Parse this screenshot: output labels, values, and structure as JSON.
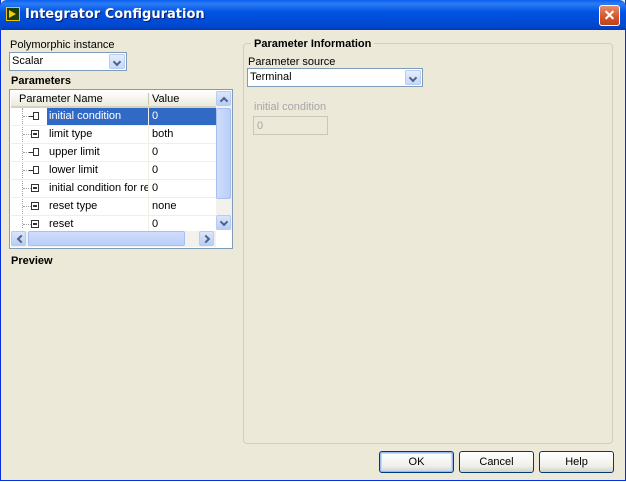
{
  "window": {
    "title": "Integrator Configuration"
  },
  "polymorphic": {
    "label": "Polymorphic instance",
    "value": "Scalar"
  },
  "parameters": {
    "title": "Parameters",
    "col_name": "Parameter Name",
    "col_value": "Value",
    "rows": [
      {
        "name": "initial condition",
        "value": "0",
        "icon": "terminal-icon",
        "selected": true
      },
      {
        "name": "limit type",
        "value": "both",
        "icon": "control-icon"
      },
      {
        "name": "upper limit",
        "value": "0",
        "icon": "terminal-icon"
      },
      {
        "name": "lower limit",
        "value": "0",
        "icon": "terminal-icon"
      },
      {
        "name": "initial condition for reset",
        "value": "0",
        "icon": "control-icon"
      },
      {
        "name": "reset type",
        "value": "none",
        "icon": "control-icon"
      },
      {
        "name": "reset",
        "value": "0",
        "icon": "control-icon"
      }
    ]
  },
  "preview": {
    "title": "Preview"
  },
  "info": {
    "title": "Parameter Information",
    "source_label": "Parameter source",
    "source_value": "Terminal",
    "field_label": "initial condition",
    "field_value": "0"
  },
  "buttons": {
    "ok": "OK",
    "cancel": "Cancel",
    "help": "Help"
  },
  "colors": {
    "titlebar": "#0054e3",
    "selection": "#316ac5",
    "dialog_bg": "#ece9d8"
  }
}
